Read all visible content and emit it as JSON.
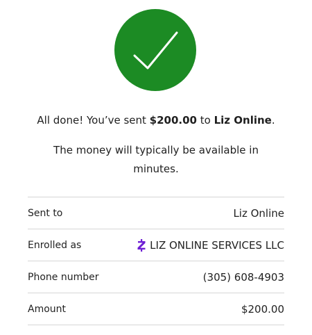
{
  "colors": {
    "success_green": "#1c8b24",
    "zelle_purple": "#6d1ed4"
  },
  "icons": {
    "success": "checkmark-icon",
    "enrolled": "zelle-z-icon"
  },
  "message": {
    "prefix": "All done! You’ve sent ",
    "amount": "$200.00",
    "middle": " to ",
    "recipient": "Liz Online",
    "suffix": ".",
    "availability": "The money will typically be available in minutes."
  },
  "details": [
    {
      "label": "Sent to",
      "value": "Liz Online"
    },
    {
      "label": "Enrolled as",
      "value": "LIZ ONLINE SERVICES LLC"
    },
    {
      "label": "Phone number",
      "value": "(305) 608-4903"
    },
    {
      "label": "Amount",
      "value": "$200.00"
    }
  ]
}
